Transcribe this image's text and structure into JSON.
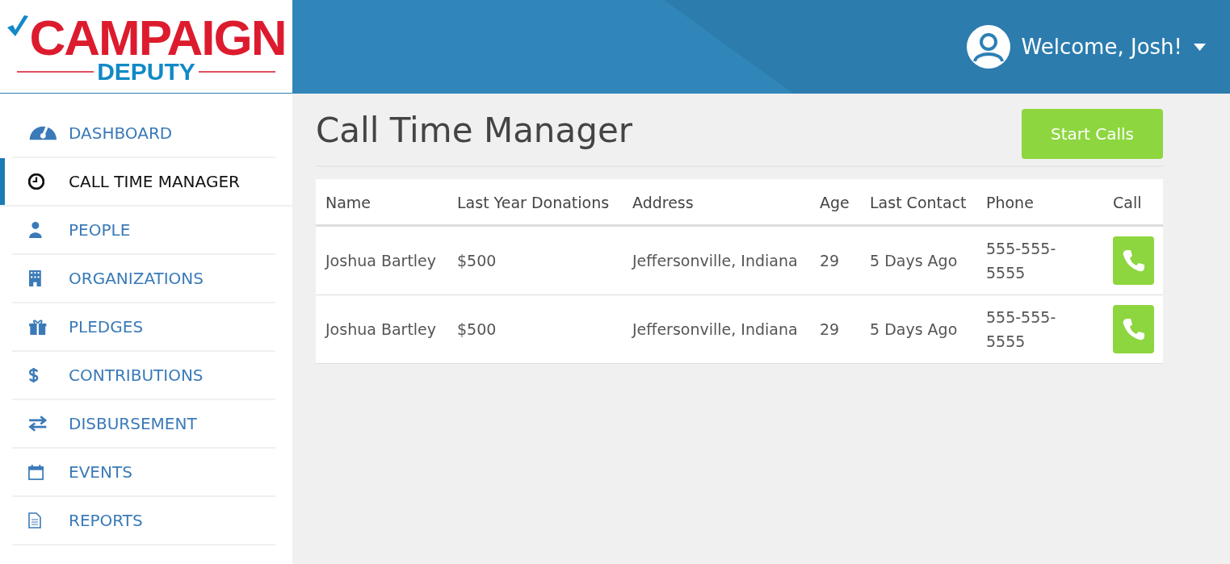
{
  "logo": {
    "top": "CAMPAIGN",
    "bottom": "DEPUTY"
  },
  "user": {
    "greeting": "Welcome, Josh!"
  },
  "sidebar": {
    "items": [
      {
        "label": "DASHBOARD",
        "selected": false
      },
      {
        "label": "CALL TIME MANAGER",
        "selected": true
      },
      {
        "label": "PEOPLE",
        "selected": false
      },
      {
        "label": "ORGANIZATIONS",
        "selected": false
      },
      {
        "label": "PLEDGES",
        "selected": false
      },
      {
        "label": "CONTRIBUTIONS",
        "selected": false
      },
      {
        "label": "DISBURSEMENT",
        "selected": false
      },
      {
        "label": "EVENTS",
        "selected": false
      },
      {
        "label": "REPORTS",
        "selected": false
      }
    ]
  },
  "page": {
    "title": "Call Time Manager",
    "action": "Start Calls"
  },
  "table": {
    "columns": [
      "Name",
      "Last Year Donations",
      "Address",
      "Age",
      "Last Contact",
      "Phone",
      "Call"
    ],
    "rows": [
      {
        "name": "Joshua Bartley",
        "donations": "$500",
        "address": "Jeffersonville, Indiana",
        "age": "29",
        "last_contact": "5 Days Ago",
        "phone": "555-555-5555"
      },
      {
        "name": "Joshua Bartley",
        "donations": "$500",
        "address": "Jeffersonville, Indiana",
        "age": "29",
        "last_contact": "5 Days Ago",
        "phone": "555-555-5555"
      }
    ]
  }
}
